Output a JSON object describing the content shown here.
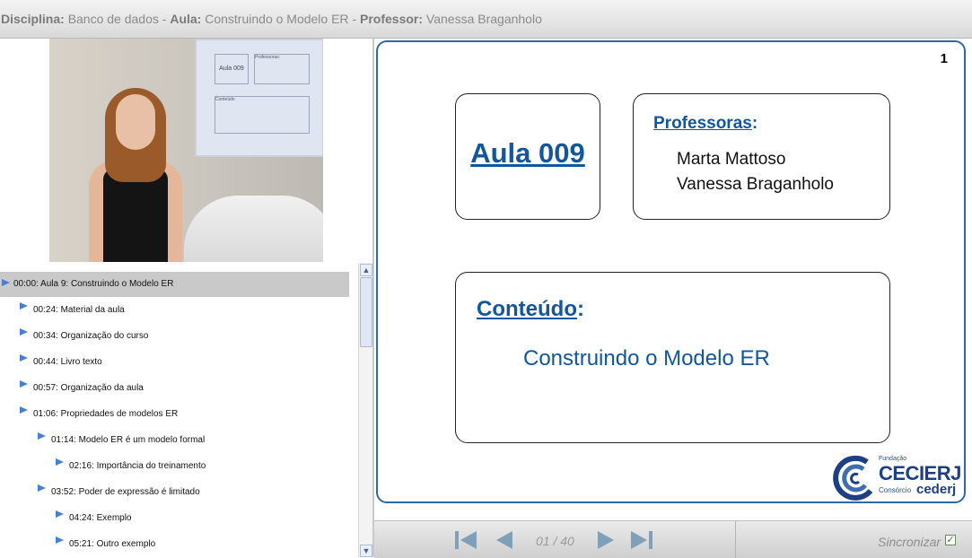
{
  "header": {
    "disciplina_label": "Disciplina:",
    "disciplina": "Banco de dados",
    "aula_label": "Aula:",
    "aula": "Construindo o Modelo ER",
    "professor_label": "Professor:",
    "professor": "Vanessa Braganholo",
    "sep": " - "
  },
  "video": {
    "screen_box1": "Aula 009",
    "screen_box2": "Professoras:",
    "screen_box3": "Conteúdo"
  },
  "chapters": [
    {
      "text": "00:00: Aula 9: Construindo o Modelo ER",
      "level": 0,
      "selected": true
    },
    {
      "text": "00:24: Material da aula",
      "level": 1
    },
    {
      "text": "00:34: Organização do curso",
      "level": 1
    },
    {
      "text": "00:44: Livro texto",
      "level": 1
    },
    {
      "text": "00:57: Organização da aula",
      "level": 1
    },
    {
      "text": "01:06: Propriedades de modelos ER",
      "level": 1
    },
    {
      "text": "01:14: Modelo ER é um modelo formal",
      "level": 2
    },
    {
      "text": "02:16: Importância do treinamento",
      "level": 3
    },
    {
      "text": "03:52: Poder de expressão é limitado",
      "level": 2
    },
    {
      "text": "04:24: Exemplo",
      "level": 3
    },
    {
      "text": "05:21: Outro exemplo",
      "level": 3
    }
  ],
  "slide": {
    "number": "1",
    "aula_title": "Aula 009",
    "professoras_heading": "Professoras",
    "colon": ":",
    "professoras": [
      "Marta Mattoso",
      "Vanessa Braganholo"
    ],
    "conteudo_heading": "Conteúdo",
    "conteudo_text": "Construindo o Modelo ER",
    "logo": {
      "fundacao": "Fundação",
      "name": "CECIERJ",
      "consorcio": "Consórcio",
      "cederj": "cederj"
    }
  },
  "controls": {
    "page": "01 / 40",
    "sync_label": "Sincronizar",
    "sync_checked": true
  },
  "colors": {
    "accent": "#12569c",
    "border": "#2d6aa5",
    "arrow": "#4a7ed2",
    "control": "#7fa0b8"
  }
}
